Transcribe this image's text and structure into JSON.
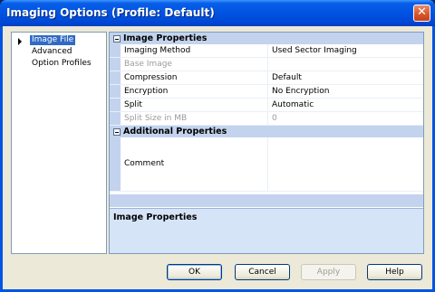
{
  "window": {
    "title": "Imaging Options (Profile: Default)",
    "close_label": "✕"
  },
  "nav": {
    "items": [
      {
        "label": "Image File",
        "selected": true
      },
      {
        "label": "Advanced",
        "selected": false
      },
      {
        "label": "Option Profiles",
        "selected": false
      }
    ]
  },
  "grid": {
    "categories": [
      {
        "label": "Image Properties"
      },
      {
        "label": "Additional Properties"
      }
    ],
    "properties": [
      {
        "name": "Imaging Method",
        "value": "Used Sector Imaging",
        "enabled": true
      },
      {
        "name": "Base Image",
        "value": "",
        "enabled": false
      },
      {
        "name": "Compression",
        "value": "Default",
        "enabled": true
      },
      {
        "name": "Encryption",
        "value": "No Encryption",
        "enabled": true
      },
      {
        "name": "Split",
        "value": "Automatic",
        "enabled": true
      },
      {
        "name": "Split Size in MB",
        "value": "0",
        "enabled": false
      }
    ],
    "comment": {
      "name": "Comment",
      "value": ""
    }
  },
  "help_pane": {
    "title": "Image Properties",
    "description": ""
  },
  "buttons": {
    "ok": "OK",
    "cancel": "Cancel",
    "apply": "Apply",
    "help": "Help"
  }
}
